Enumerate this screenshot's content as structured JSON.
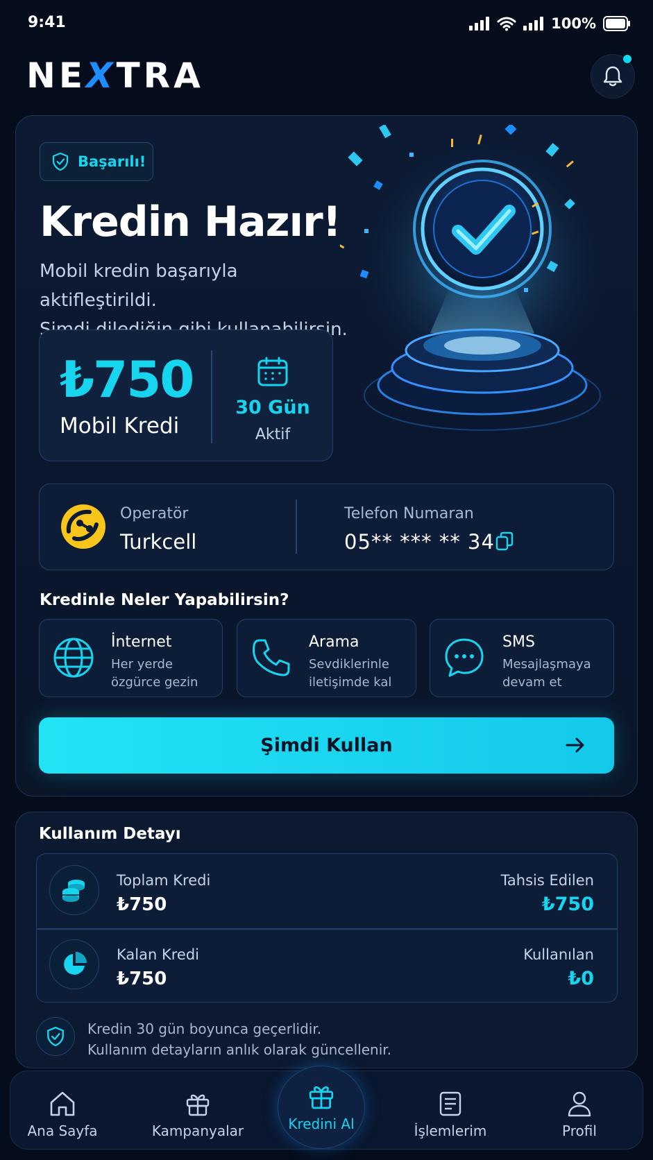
{
  "status": {
    "time": "9:41",
    "battery": "100%"
  },
  "brand": {
    "logo_pre": "NE",
    "logo_x": "X",
    "logo_post": "TRA"
  },
  "hero": {
    "badge": "Başarılı!",
    "title": "Kredin Hazır!",
    "subtitle_line1": "Mobil kredin başarıyla aktifleştirildi.",
    "subtitle_line2": "Şimdi dilediğin gibi kullanabilirsin.",
    "amount": "₺750",
    "amount_label": "Mobil Kredi",
    "days": "30 Gün",
    "days_label": "Aktif"
  },
  "operator": {
    "label": "Operatör",
    "value": "Turkcell",
    "phone_label": "Telefon Numaran",
    "phone_value": "05** *** ** 34"
  },
  "features": {
    "title": "Kredinle Neler Yapabilirsin?",
    "items": [
      {
        "title": "İnternet",
        "desc1": "Her yerde",
        "desc2": "özgürce gezin",
        "icon": "globe-icon"
      },
      {
        "title": "Arama",
        "desc1": "Sevdiklerinle",
        "desc2": "iletişimde kal",
        "icon": "phone-icon"
      },
      {
        "title": "SMS",
        "desc1": "Mesajlaşmaya",
        "desc2": "devam et",
        "icon": "chat-icon"
      }
    ]
  },
  "cta": {
    "label": "Şimdi Kullan"
  },
  "usage": {
    "title": "Kullanım Detayı",
    "rows": [
      {
        "label": "Toplam Kredi",
        "value": "₺750",
        "right_label": "Tahsis Edilen",
        "right_value": "₺750",
        "icon": "coins-icon"
      },
      {
        "label": "Kalan Kredi",
        "value": "₺750",
        "right_label": "Kullanılan",
        "right_value": "₺0",
        "icon": "pie-chart-icon"
      }
    ],
    "note_line1": "Kredin 30 gün boyunca geçerlidir.",
    "note_line2": "Kullanım detayların anlık olarak güncellenir."
  },
  "nav": {
    "items": [
      {
        "label": "Ana Sayfa",
        "icon": "home-icon"
      },
      {
        "label": "Kampanyalar",
        "icon": "gift-icon"
      },
      {
        "label": "Kredini Al",
        "icon": "gift-icon",
        "active": true
      },
      {
        "label": "İşlemlerim",
        "icon": "document-icon"
      },
      {
        "label": "Profil",
        "icon": "user-icon"
      }
    ]
  },
  "colors": {
    "accent": "#18d5ef",
    "background": "#050d1c",
    "brand_blue": "#1e8dff",
    "operator_yellow": "#f7c51c"
  }
}
